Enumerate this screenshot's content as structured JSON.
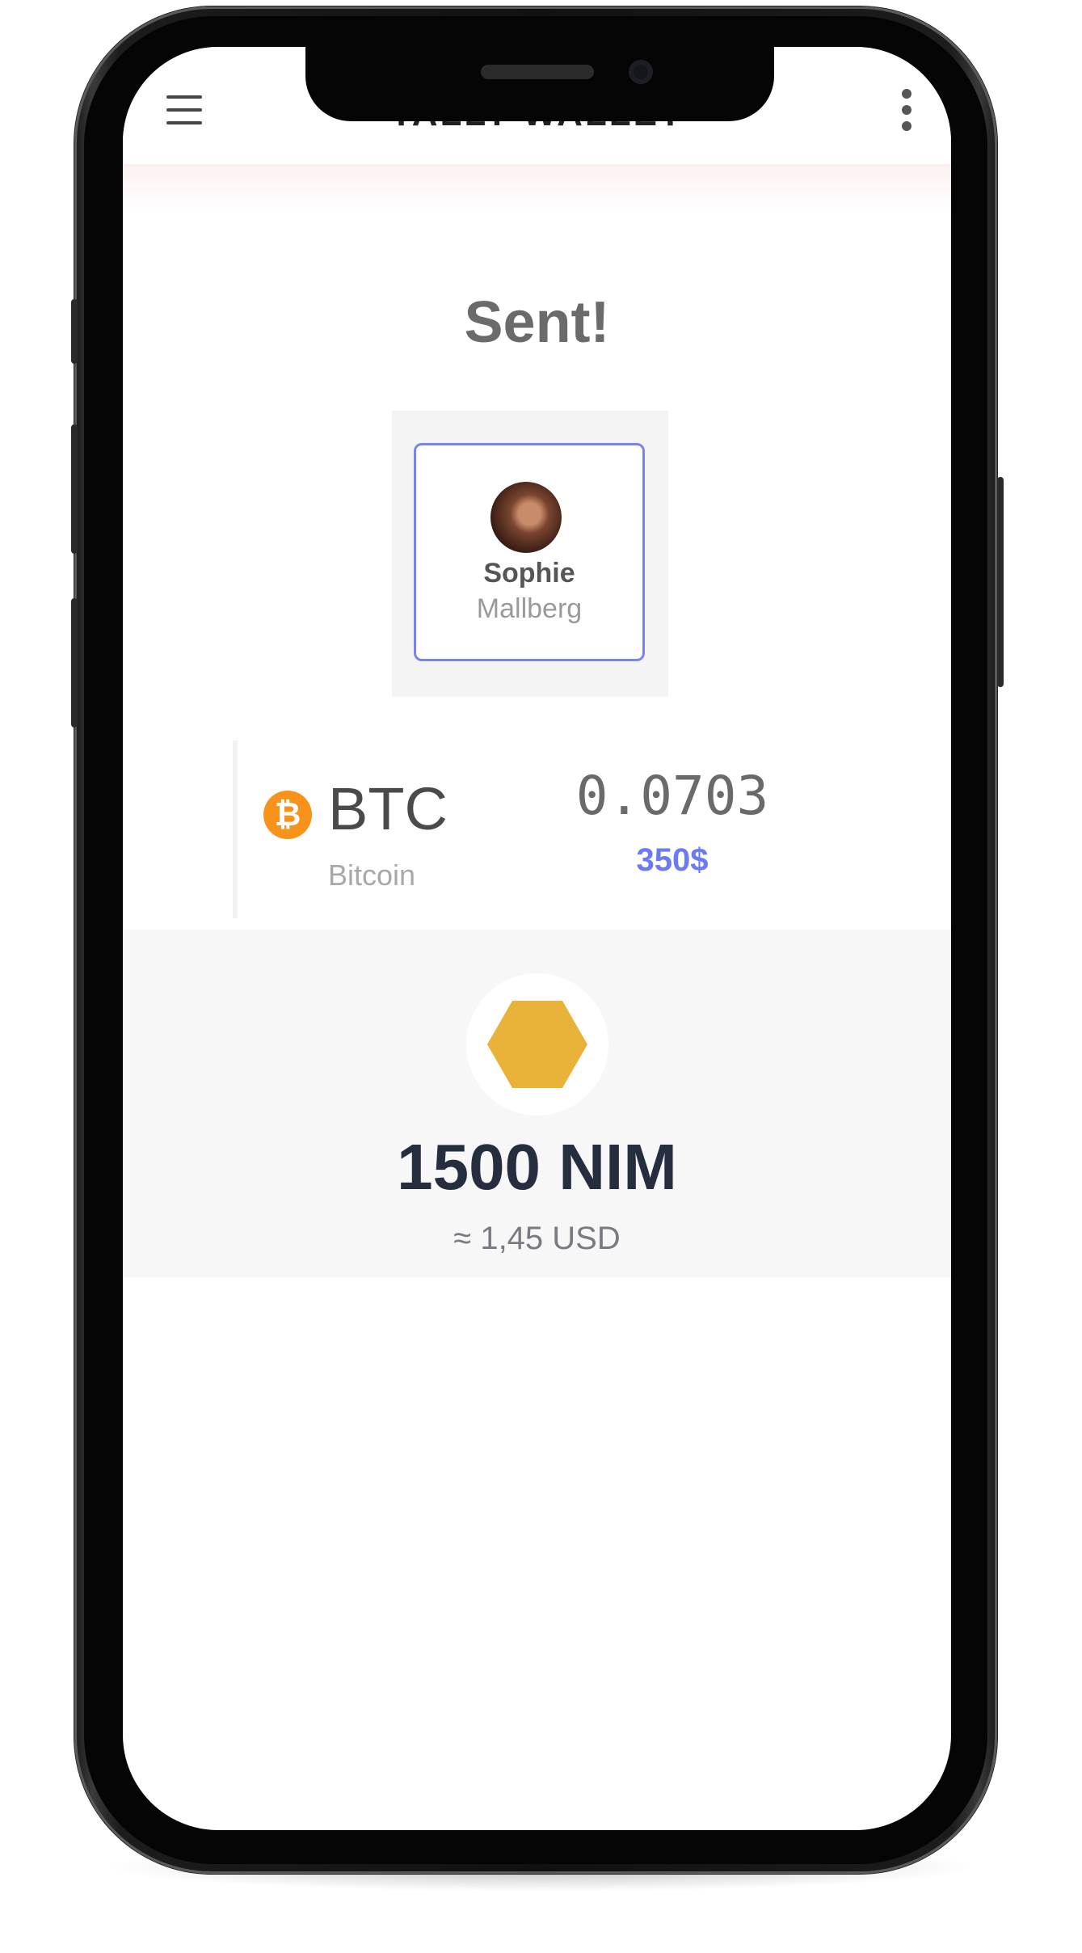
{
  "header": {
    "title": "TALLY WALLET",
    "menu_icon": "hamburger-menu-icon",
    "more_icon": "more-vertical-icon"
  },
  "status": {
    "title": "Sent!"
  },
  "recipient": {
    "first_name": "Sophie",
    "last_name": "Mallberg",
    "avatar_icon": "avatar"
  },
  "asset": {
    "icon_glyph": "₿",
    "symbol": "BTC",
    "name": "Bitcoin",
    "amount": "0.0703",
    "fiat": "350$"
  },
  "nim": {
    "icon": "nimiq-hexagon-icon",
    "amount": "1500 NIM",
    "fiat": "≈ 1,45 USD"
  },
  "colors": {
    "accent_blue": "#6b7af5",
    "bitcoin_orange": "#f7931a",
    "nim_gold": "#e9b33a",
    "title_gray": "#6b6b6b",
    "dark_navy": "#262d3f"
  }
}
